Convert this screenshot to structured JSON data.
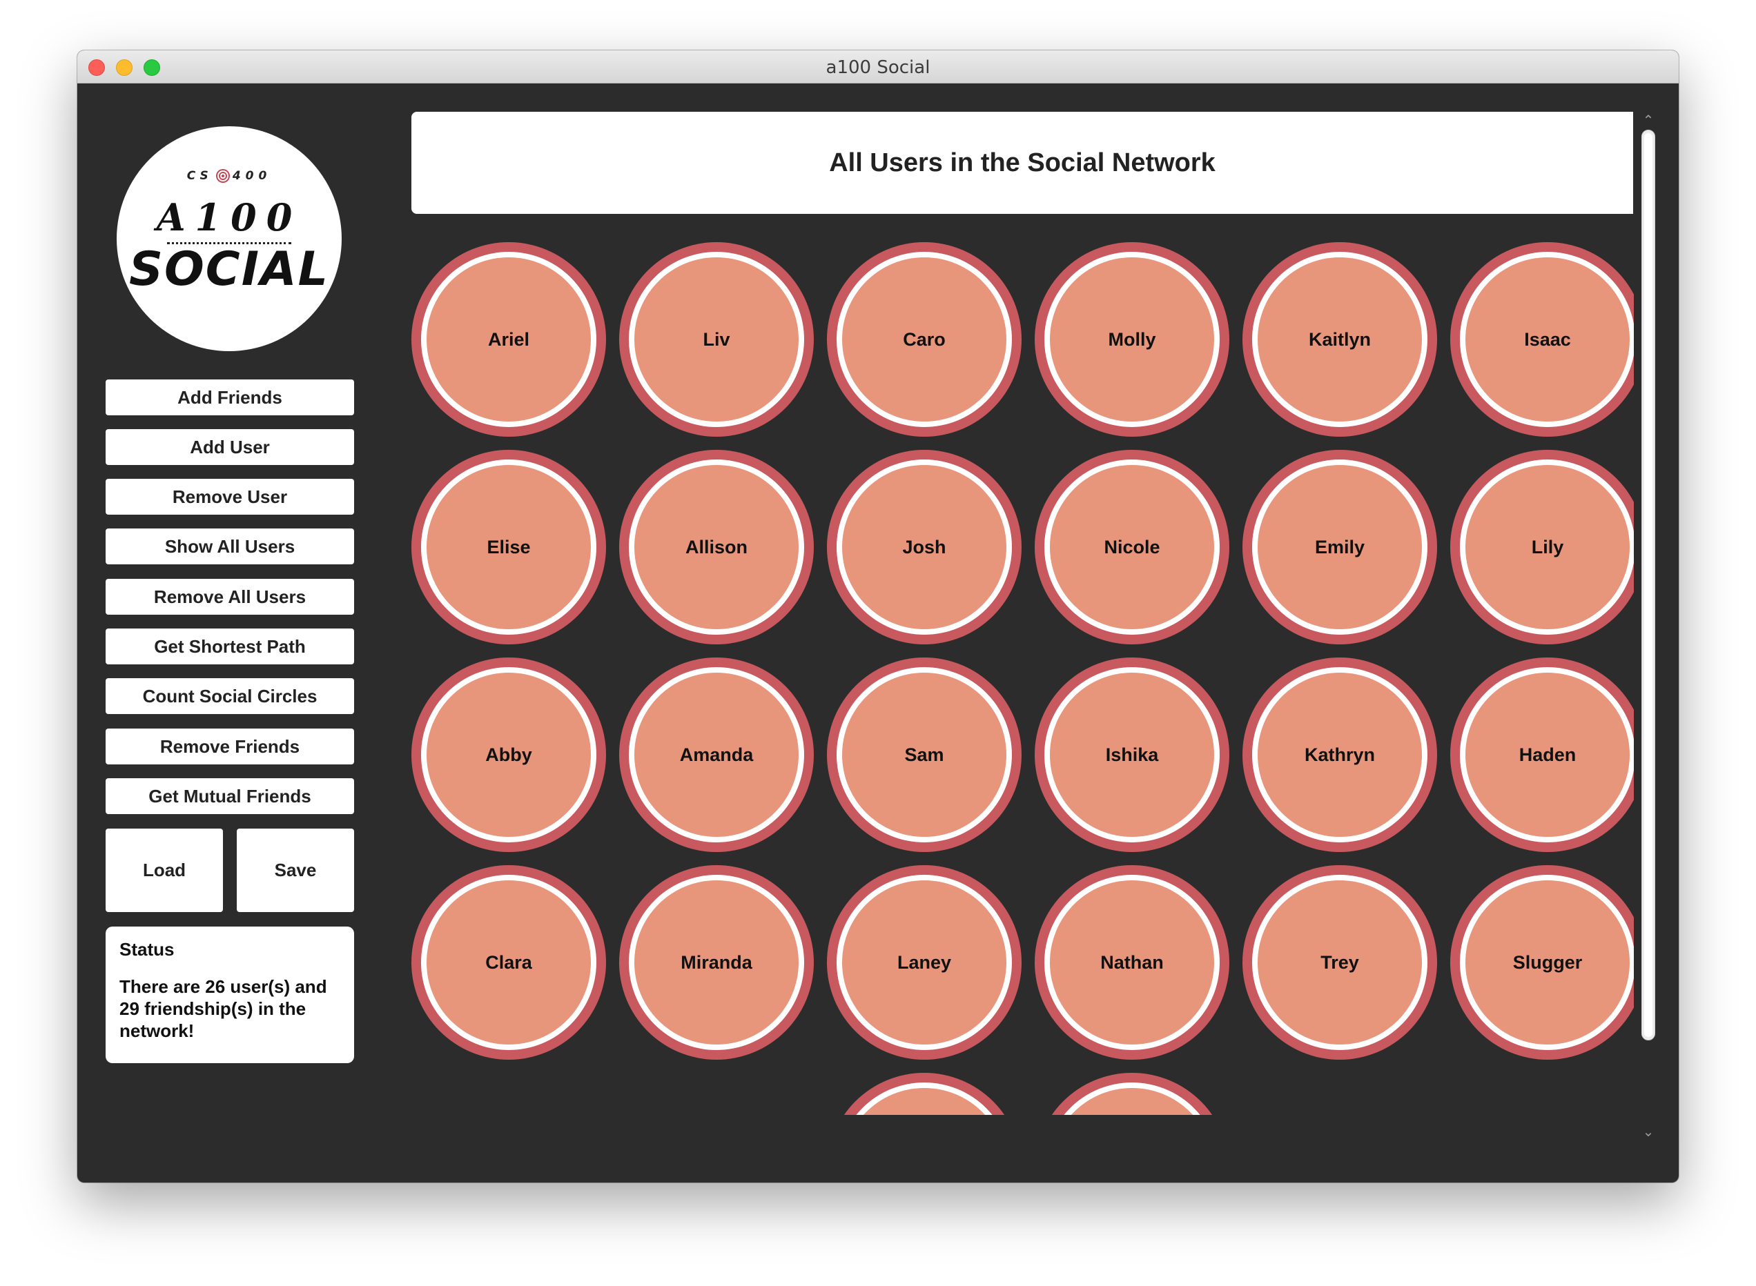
{
  "window": {
    "title": "a100 Social"
  },
  "logo": {
    "top_left": "CS",
    "top_right": "400",
    "line1": "A100",
    "line2": "SOCIAL"
  },
  "sidebar": {
    "buttons": [
      {
        "label": "Add Friends"
      },
      {
        "label": "Add User"
      },
      {
        "label": "Remove User"
      },
      {
        "label": "Show All Users"
      },
      {
        "label": "Remove All Users"
      },
      {
        "label": "Get Shortest Path"
      },
      {
        "label": "Count Social Circles"
      },
      {
        "label": "Remove Friends"
      },
      {
        "label": "Get Mutual Friends"
      }
    ],
    "load_label": "Load",
    "save_label": "Save"
  },
  "status": {
    "title": "Status",
    "message": "There are 26 user(s) and 29 friendship(s) in the network!"
  },
  "main": {
    "title": "All Users in the Social Network",
    "users": [
      "Ariel",
      "Liv",
      "Caro",
      "Molly",
      "Kaitlyn",
      "Isaac",
      "Elise",
      "Allison",
      "Josh",
      "Nicole",
      "Emily",
      "Lily",
      "Abby",
      "Amanda",
      "Sam",
      "Ishika",
      "Kathryn",
      "Haden",
      "Clara",
      "Miranda",
      "Laney",
      "Nathan",
      "Trey",
      "Slugger",
      "",
      ""
    ]
  },
  "colors": {
    "background": "#2c2c2c",
    "user_outer": "#c85a5f",
    "user_inner": "#e8967b",
    "card": "#ffffff"
  }
}
